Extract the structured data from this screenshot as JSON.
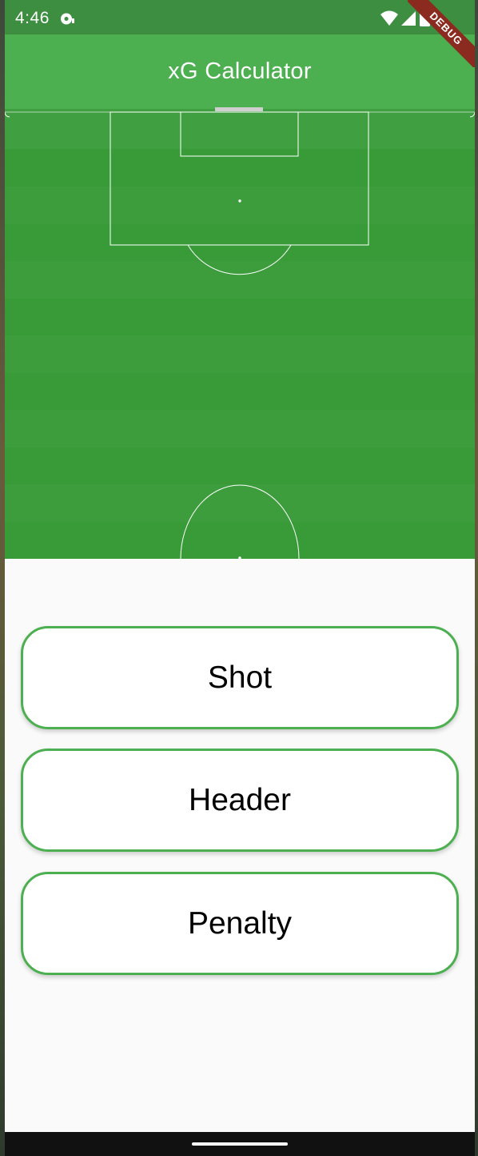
{
  "status_bar": {
    "time": "4:46",
    "icons": [
      "app-notification-icon",
      "wifi-icon",
      "cellular-signal-icon",
      "battery-icon"
    ]
  },
  "debug_banner": {
    "label": "DEBUG"
  },
  "app_bar": {
    "title": "xG Calculator"
  },
  "pitch": {
    "icon": "football-pitch-half",
    "colors": {
      "stripe_light": "#409f40",
      "stripe_dark": "#379a37",
      "lines": "#ffffff"
    }
  },
  "actions": {
    "shot": "Shot",
    "header": "Header",
    "penalty": "Penalty"
  },
  "colors": {
    "primary": "#4caf50",
    "status_bar": "#3e8e41",
    "background": "#fafafa",
    "button_border": "#4caf50"
  }
}
